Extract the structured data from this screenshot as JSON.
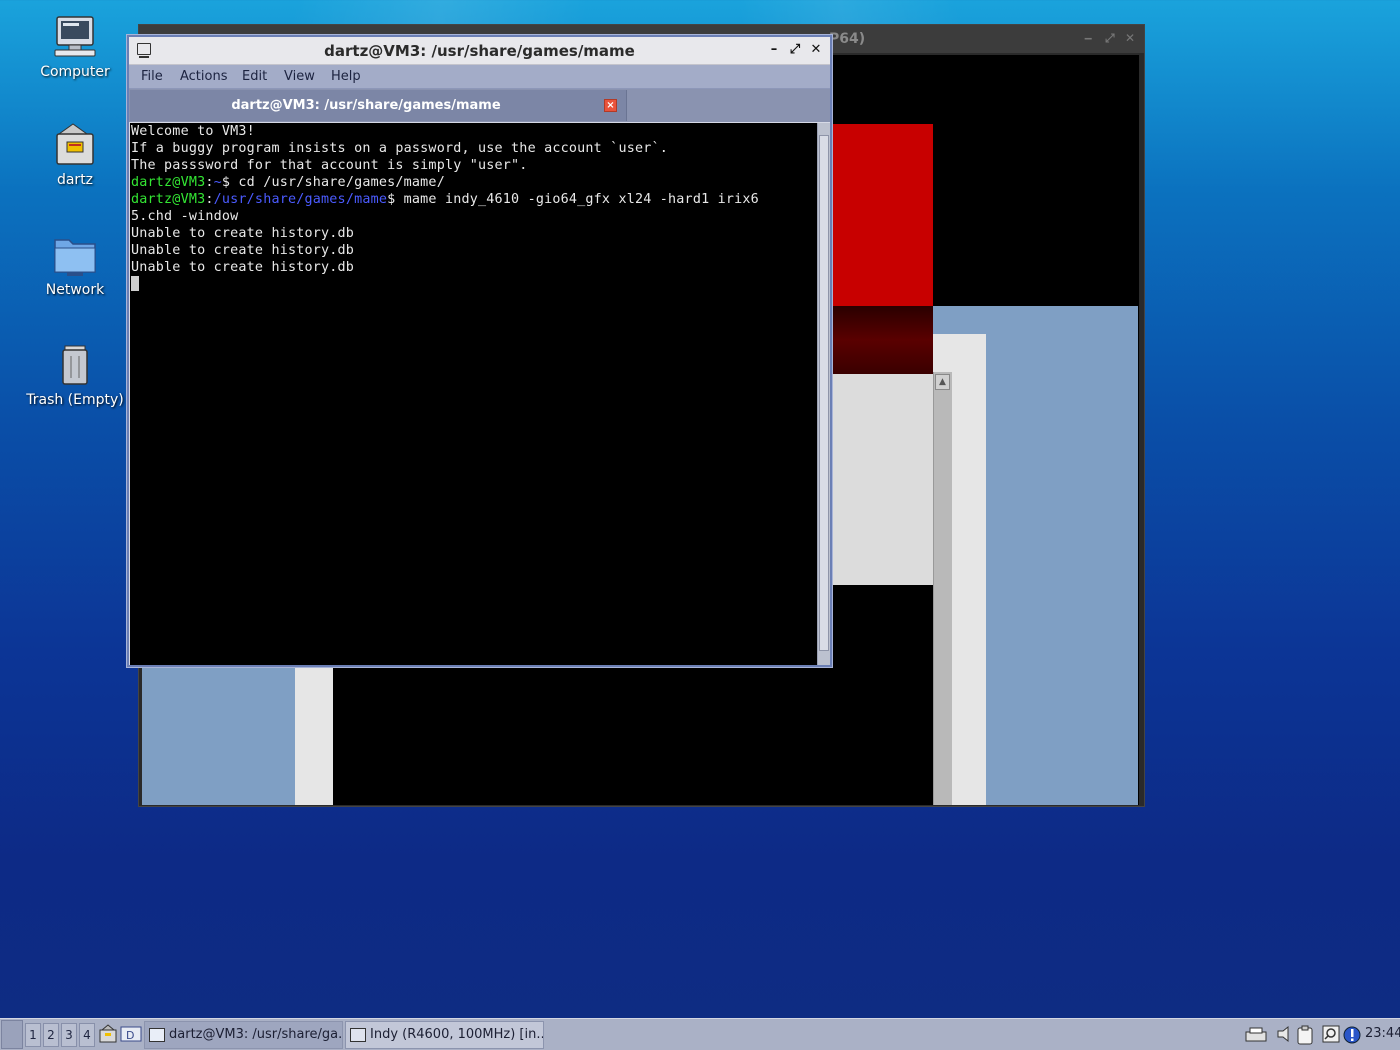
{
  "desktop": {
    "icons": [
      {
        "label": "Computer",
        "icon": "computer-icon"
      },
      {
        "label": "dartz",
        "icon": "home-folder-icon"
      },
      {
        "label": "Network",
        "icon": "network-icon"
      },
      {
        "label": "Trash (Empty)",
        "icon": "trash-icon"
      }
    ]
  },
  "mame_window": {
    "title_fragment": "P64)",
    "colors": {
      "red": "#c80000",
      "dark_red": "#5a0000",
      "blue_grey": "#7f9fc4",
      "light_grey": "#e0e0e0"
    }
  },
  "terminal": {
    "title": "dartz@VM3: /usr/share/games/mame",
    "menu": [
      "File",
      "Actions",
      "Edit",
      "View",
      "Help"
    ],
    "tab_label": "dartz@VM3: /usr/share/games/mame",
    "lines": {
      "l1": "Welcome to VM3!",
      "l2": "If a buggy program insists on a password, use the account `user`.",
      "l3": "The passsword for that account is simply \"user\".",
      "l4_user": "dartz@VM3",
      "l4_sep": ":",
      "l4_path": "~",
      "l4_cmd": "$ cd /usr/share/games/mame/",
      "l5_user": "dartz@VM3",
      "l5_sep": ":",
      "l5_path": "/usr/share/games/mame",
      "l5_cmd": "$ mame indy_4610 -gio64_gfx xl24 -hard1 irix6",
      "l6": "5.chd -window",
      "l7": "Unable to create history.db",
      "l8": "Unable to create history.db",
      "l9": "Unable to create history.db"
    },
    "colors": {
      "prompt_user": "#33e633",
      "prompt_path": "#4b5bff"
    }
  },
  "taskbar": {
    "workspaces": [
      "1",
      "2",
      "3",
      "4"
    ],
    "tasks": [
      {
        "label": "dartz@VM3: /usr/share/ga...",
        "icon": "terminal-icon"
      },
      {
        "label": "Indy (R4600, 100MHz) [in...",
        "icon": "window-icon"
      }
    ],
    "clock": "23:44"
  }
}
